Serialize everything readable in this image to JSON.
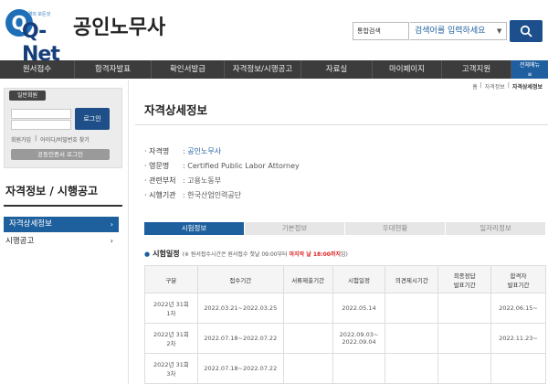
{
  "header": {
    "logo_text": "Q-Net",
    "logo_sub": "자격의 모든것",
    "site_title": "공인노무사",
    "search_scope": "통합검색",
    "search_placeholder": "검색어를 입력하세요",
    "colors": {
      "brand": "#1f5fa0",
      "nav_bg": "#3c3c3c",
      "accent_red": "#dd2222"
    }
  },
  "nav": {
    "items": [
      "원서접수",
      "합격자발표",
      "확인서발급",
      "자격정보/시행공고",
      "자료실",
      "마이페이지",
      "고객지원"
    ],
    "all_menu": "전체메뉴"
  },
  "breadcrumb": [
    "홈",
    "자격정보",
    "자격상세정보"
  ],
  "login": {
    "badge": "일반회원",
    "button": "로그인",
    "links": [
      "회원가입",
      "아이디/비밀번호 찾기"
    ],
    "cert_login": "공동인증서 로그인"
  },
  "sidebar": {
    "title": "자격정보 / 시행공고",
    "items": [
      {
        "label": "자격상세정보",
        "active": true
      },
      {
        "label": "시행공고",
        "active": false
      }
    ]
  },
  "content": {
    "title": "자격상세정보",
    "info": [
      {
        "label": "자격명",
        "value": "공인노무사"
      },
      {
        "label": "영문명",
        "value": "Certified Public Labor Attorney"
      },
      {
        "label": "관련부처",
        "value": "고용노동부"
      },
      {
        "label": "시행기관",
        "value": "한국산업인력공단"
      }
    ],
    "tabs": [
      "시험정보",
      "기본정보",
      "우대현황",
      "일자리정보"
    ],
    "schedule": {
      "title": "시험일정",
      "note_prefix": "(※ 원서접수시간은 원서접수 첫날 09:00부터",
      "note_red": "마지막 날 18:00까지",
      "note_suffix": "임)"
    },
    "table": {
      "headers": [
        "구분",
        "접수기간",
        "서류제출기간",
        "시험일정",
        "의견제시기간",
        "최종정답\n발표기간",
        "합격자\n발표기간"
      ],
      "rows": [
        [
          "2022년 31회\n1차",
          "2022.03.21~2022.03.25",
          "",
          "2022.05.14",
          "",
          "",
          "2022.06.15~"
        ],
        [
          "2022년 31회\n2차",
          "2022.07.18~2022.07.22",
          "",
          "2022.09.03~\n2022.09.04",
          "",
          "",
          "2022.11.23~"
        ],
        [
          "2022년 31회\n3차",
          "2022.07.18~2022.07.22",
          "",
          "",
          "",
          "",
          ""
        ]
      ]
    }
  }
}
